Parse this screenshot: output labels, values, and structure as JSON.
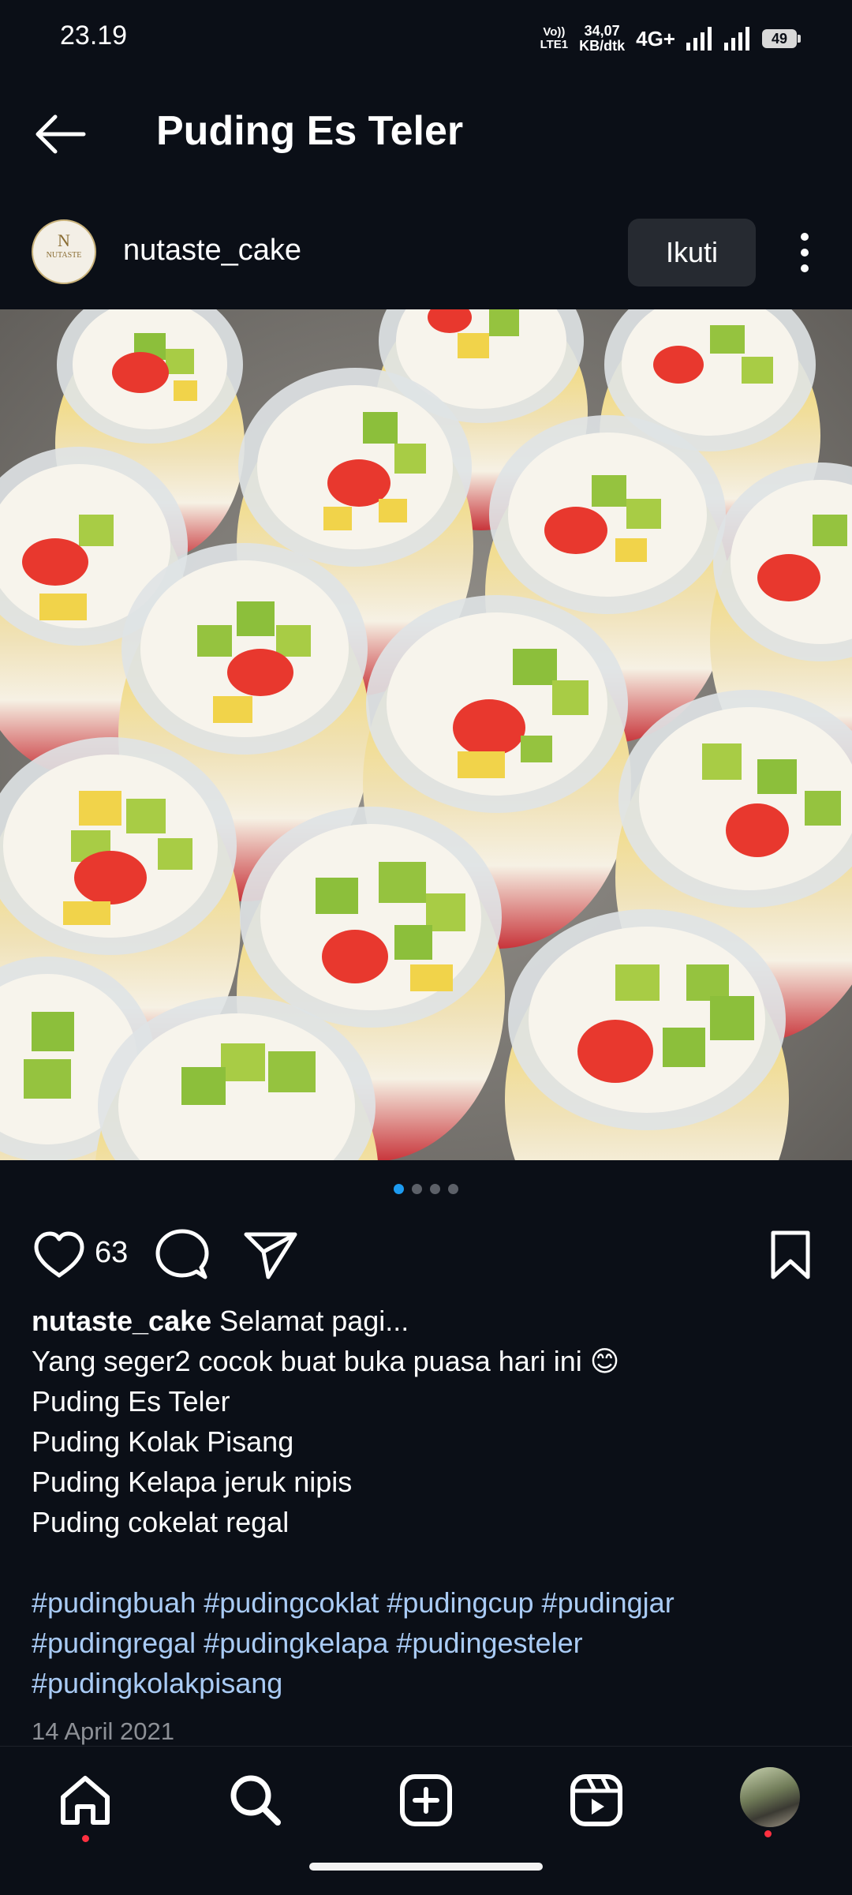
{
  "status_bar": {
    "time": "23.19",
    "volte_top": "Vo))",
    "volte_bottom": "LTE1",
    "netspeed_value": "34,07",
    "netspeed_unit": "KB/dtk",
    "network": "4G+",
    "battery": "49"
  },
  "header": {
    "title": "Puding Es Teler"
  },
  "post": {
    "username": "nutaste_cake",
    "avatar_text": "NUTASTE",
    "follow_label": "Ikuti",
    "carousel_total": 4,
    "carousel_active": 1,
    "likes": "63",
    "caption": {
      "username": "nutaste_cake",
      "first_line": "Selamat pagi...",
      "lines": [
        "Yang seger2 cocok buat buka puasa hari ini 😊",
        "Puding Es Teler",
        "Puding Kolak Pisang",
        "Puding Kelapa jeruk nipis",
        "Puding cokelat regal"
      ],
      "hashtags": [
        "#pudingbuah  #pudingcoklat #pudingcup #pudingjar",
        "#pudingregal #pudingkelapa #pudingesteler",
        "#pudingkolakpisang"
      ]
    },
    "date": "14 April 2021"
  },
  "colors": {
    "background": "#0b0f17",
    "button_bg": "#262a31",
    "hashtag": "#a9cbf5",
    "active_dot": "#1d9bf0",
    "notification": "#ff3040"
  },
  "bottom_nav": {
    "items": [
      "home-icon",
      "search-icon",
      "create-icon",
      "reels-icon",
      "profile-avatar"
    ]
  }
}
